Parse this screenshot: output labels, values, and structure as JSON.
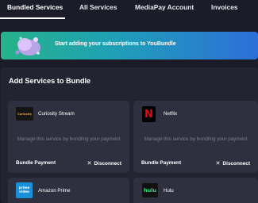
{
  "tabs": [
    {
      "label": "Bundled Services",
      "active": true
    },
    {
      "label": "All Services",
      "active": false
    },
    {
      "label": "MediaPay Account",
      "active": false
    },
    {
      "label": "Invoices",
      "active": false
    }
  ],
  "banner": {
    "text": "Start adding your subscriptions to YouBundle",
    "gradient": [
      "#27b389",
      "#2c6fd8"
    ]
  },
  "section": {
    "title": "Add Services to Bundle"
  },
  "cards": [
    {
      "name": "Curiosity Stream",
      "logo_text": "Curiosity",
      "logo_icon": "curiosity-stream-logo",
      "description": "Manage this service by bundling your payment",
      "bundle_label": "Bundle Payment",
      "disconnect_label": "Disconnect"
    },
    {
      "name": "Netflix",
      "logo_text": "N",
      "logo_icon": "netflix-logo",
      "description": "Manage this service by bundling your payment",
      "bundle_label": "Bundle Payment",
      "disconnect_label": "Disconnect"
    },
    {
      "name": "Amazon Prime",
      "logo_text": "prime video",
      "logo_icon": "prime-video-logo"
    },
    {
      "name": "Hulu",
      "logo_text": "hulu",
      "logo_icon": "hulu-logo"
    }
  ],
  "colors": {
    "background": "#1b1c27",
    "section": "#232431",
    "card": "#2e3040",
    "muted_text": "#7b7e93",
    "netflix_red": "#e50914",
    "hulu_green": "#1ce783",
    "prime_blue": "#1a8fd9"
  }
}
